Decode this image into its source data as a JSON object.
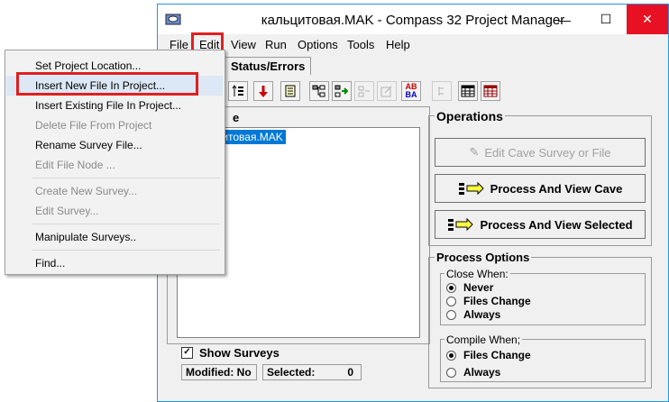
{
  "window": {
    "title": "кальцитовая.MAK - Compass 32 Project Manager",
    "controls": {
      "minimize": "—",
      "maximize": "☐",
      "close": "✕"
    }
  },
  "menubar": [
    "File",
    "Edit",
    "View",
    "Run",
    "Options",
    "Tools",
    "Help"
  ],
  "tabs": {
    "status_errors": "Status/Errors"
  },
  "tree": {
    "heading": "e",
    "node": "кальцитовая.MAK"
  },
  "show_surveys": {
    "label": "Show Surveys",
    "checked": true,
    "mark": "✓"
  },
  "status": {
    "modified": "Modified: No",
    "selected_label": "Selected:",
    "selected_value": "0"
  },
  "operations": {
    "title": "Operations",
    "edit_cave": "Edit Cave Survey or File",
    "process_view_cave": "Process And View Cave",
    "process_view_selected": "Process And View Selected"
  },
  "process_options": {
    "title": "Process Options",
    "close_when": {
      "title": "Close When:",
      "options": [
        "Never",
        "Files Change",
        "Always"
      ],
      "selected": "Never"
    },
    "compile_when": {
      "title": "Compile When;",
      "options": [
        "Files Change",
        "Always"
      ],
      "selected": "Files Change"
    }
  },
  "edit_menu": {
    "items": [
      {
        "label": "Set Project Location...",
        "enabled": true
      },
      {
        "label": "Insert New File In Project...",
        "enabled": true,
        "highlighted": true
      },
      {
        "label": "Insert Existing File In Project...",
        "enabled": true
      },
      {
        "label": "Delete File From Project",
        "enabled": false
      },
      {
        "label": "Rename Survey File...",
        "enabled": true
      },
      {
        "label": "Edit File Node ...",
        "enabled": false
      },
      {
        "label": "Create New Survey...",
        "enabled": false
      },
      {
        "label": "Edit Survey...",
        "enabled": false
      },
      {
        "label": "Manipulate Surveys..",
        "enabled": true
      },
      {
        "label": "Find...",
        "enabled": true
      }
    ]
  },
  "toolbar_glyphs": {
    "ab_top": "AB",
    "ab_bottom": "BA"
  },
  "colors": {
    "highlight_red": "#e02020",
    "selection_blue": "#0078d7",
    "close_red": "#e81123"
  }
}
